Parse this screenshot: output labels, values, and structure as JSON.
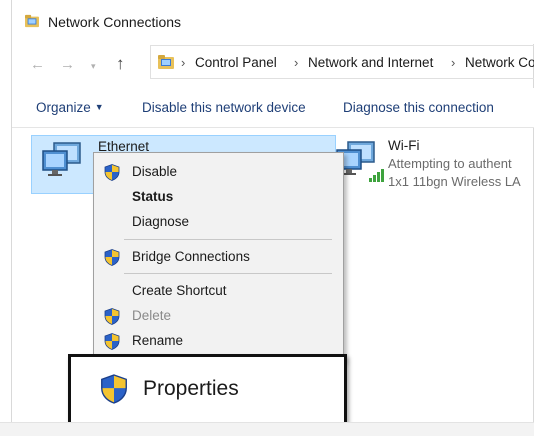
{
  "window": {
    "title": "Network Connections"
  },
  "address_bar": {
    "crumbs": [
      "Control Panel",
      "Network and Internet",
      "Network Cor"
    ]
  },
  "command_bar": {
    "organize": "Organize",
    "disable_device": "Disable this network device",
    "diagnose_connection": "Diagnose this connection"
  },
  "adapters": {
    "ethernet": {
      "name": "Ethernet",
      "icon": "network-adapter-icon"
    },
    "wifi": {
      "name": "Wi-Fi",
      "status": "Attempting to authent",
      "device": "1x1 11bgn Wireless LA",
      "icon": "wireless-adapter-icon"
    }
  },
  "context_menu": {
    "items": [
      {
        "label": "Disable",
        "icon": "shield-icon"
      },
      {
        "label": "Status",
        "bold": true
      },
      {
        "label": "Diagnose"
      },
      {
        "label": "Bridge Connections",
        "icon": "shield-icon"
      },
      {
        "label": "Create Shortcut"
      },
      {
        "label": "Delete",
        "icon": "shield-icon",
        "disabled": true
      },
      {
        "label": "Rename",
        "icon": "shield-icon"
      }
    ]
  },
  "highlight": {
    "label": "Properties",
    "icon": "shield-icon"
  },
  "colors": {
    "selection": "#cce8ff",
    "selection_border": "#99d1ff",
    "command_text": "#1f3f77",
    "menu_background": "#f2f2f2"
  }
}
